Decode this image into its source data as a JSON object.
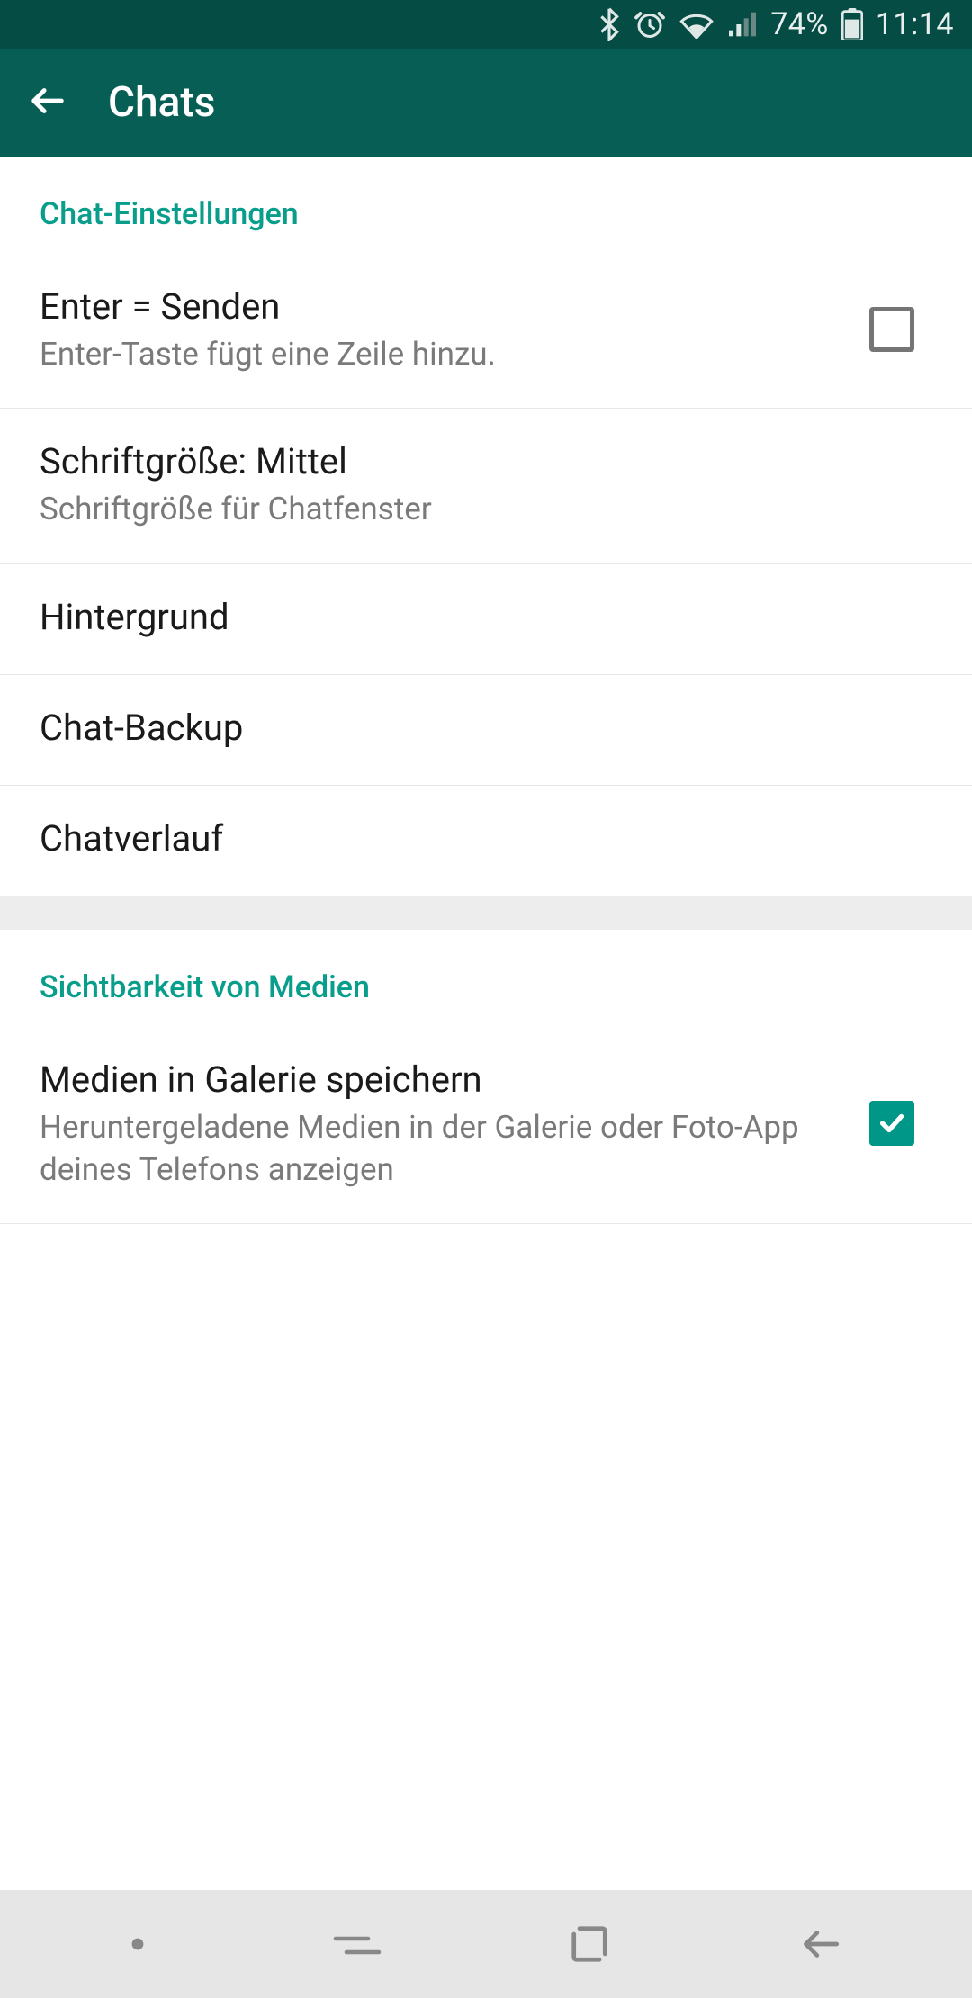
{
  "statusBar": {
    "battery": "74%",
    "time": "11:14"
  },
  "appBar": {
    "title": "Chats"
  },
  "sections": {
    "chatSettings": {
      "header": "Chat-Einstellungen",
      "enterSend": {
        "title": "Enter = Senden",
        "subtitle": "Enter-Taste fügt eine Zeile hinzu.",
        "checked": false
      },
      "fontSize": {
        "title": "Schriftgröße: Mittel",
        "subtitle": "Schriftgröße für Chatfenster"
      },
      "wallpaper": {
        "title": "Hintergrund"
      },
      "chatBackup": {
        "title": "Chat-Backup"
      },
      "chatHistory": {
        "title": "Chatverlauf"
      }
    },
    "mediaVisibility": {
      "header": "Sichtbarkeit von Medien",
      "saveMedia": {
        "title": "Medien in Galerie speichern",
        "subtitle": "Heruntergeladene Medien in der Galerie oder Foto-App deines Telefons anzeigen",
        "checked": true
      }
    }
  }
}
